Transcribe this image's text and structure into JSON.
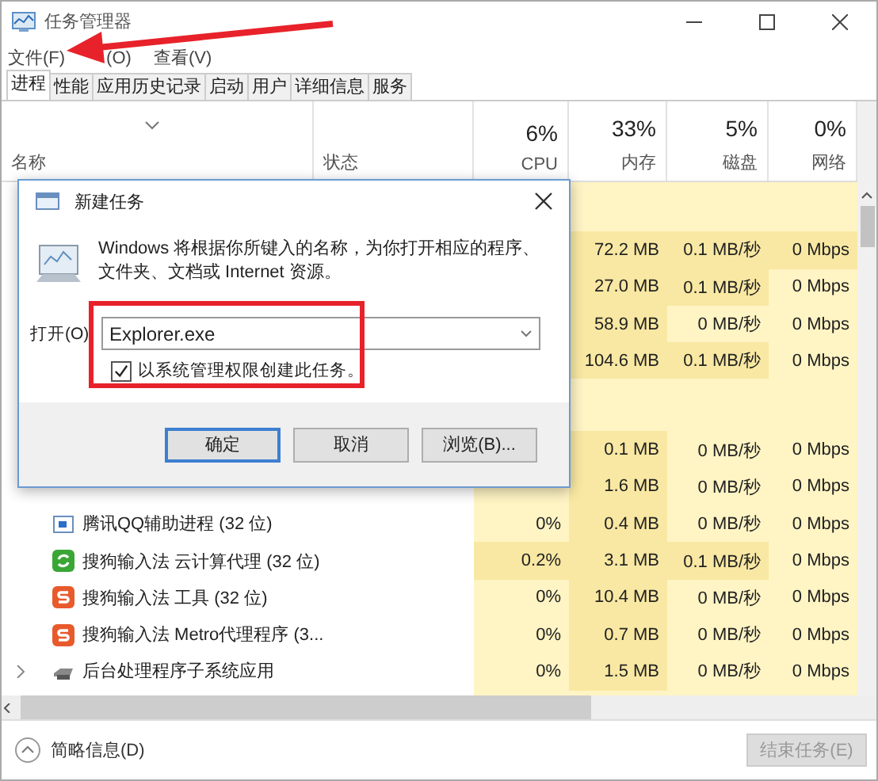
{
  "window": {
    "title": "任务管理器"
  },
  "menu": [
    "文件(F)",
    "(O)",
    "查看(V)"
  ],
  "tabs": [
    {
      "label": "进程",
      "selected": true
    },
    {
      "label": "性能",
      "selected": false
    },
    {
      "label": "应用历史记录",
      "selected": false
    },
    {
      "label": "启动",
      "selected": false
    },
    {
      "label": "用户",
      "selected": false
    },
    {
      "label": "详细信息",
      "selected": false
    },
    {
      "label": "服务",
      "selected": false
    }
  ],
  "columns": [
    {
      "label": "名称"
    },
    {
      "label": "状态"
    },
    {
      "label": "CPU",
      "total": "6%"
    },
    {
      "label": "内存",
      "total": "33%"
    },
    {
      "label": "磁盘",
      "total": "5%"
    },
    {
      "label": "网络",
      "total": "0%"
    }
  ],
  "rows": [
    {
      "kind": "group"
    },
    {
      "kind": "process",
      "memory": "72.2 MB",
      "disk": "0.1 MB/秒",
      "network": "0 Mbps",
      "disk_hot": true,
      "network_hot": true
    },
    {
      "kind": "process",
      "memory": "27.0 MB",
      "disk": "0.1 MB/秒",
      "network": "0 Mbps",
      "disk_hot": true
    },
    {
      "kind": "process",
      "memory": "58.9 MB",
      "disk": "0 MB/秒",
      "network": "0 Mbps"
    },
    {
      "kind": "process",
      "memory": "104.6 MB",
      "disk": "0.1 MB/秒",
      "network": "0 Mbps",
      "disk_hot": true
    },
    {
      "kind": "group"
    },
    {
      "kind": "process",
      "memory": "0.1 MB",
      "disk": "0 MB/秒",
      "network": "0 Mbps"
    },
    {
      "kind": "process",
      "memory": "1.6 MB",
      "disk": "0 MB/秒",
      "network": "0 Mbps"
    },
    {
      "kind": "window",
      "name": "腾讯QQ辅助进程 (32 位)",
      "cpu": "0%",
      "memory": "0.4 MB",
      "disk": "0 MB/秒",
      "network": "0 Mbps"
    },
    {
      "kind": "cloud",
      "name": "搜狗输入法 云计算代理 (32 位)",
      "cpu": "0.2%",
      "memory": "3.1 MB",
      "disk": "0.1 MB/秒",
      "network": "0 Mbps",
      "cpu_hot": true,
      "disk_hot": true
    },
    {
      "kind": "tool",
      "name": "搜狗输入法 工具 (32 位)",
      "cpu": "0%",
      "memory": "10.4 MB",
      "disk": "0 MB/秒",
      "network": "0 Mbps"
    },
    {
      "kind": "tool",
      "name": "搜狗输入法 Metro代理程序 (3...",
      "cpu": "0%",
      "memory": "0.7 MB",
      "disk": "0 MB/秒",
      "network": "0 Mbps"
    },
    {
      "kind": "service",
      "expandable": true,
      "name": "后台处理程序子系统应用",
      "cpu": "0%",
      "memory": "1.5 MB",
      "disk": "0 MB/秒",
      "network": "0 Mbps"
    }
  ],
  "footer": {
    "details": "简略信息(D)",
    "end_task": {
      "label": "结束任务(E)",
      "disabled": true
    }
  },
  "dialog": {
    "title": "新建任务",
    "message": "Windows 将根据你所键入的名称，为你打开相应的程序、文件夹、文档或 Internet 资源。",
    "open_label": "打开(O)",
    "value": "Explorer.exe",
    "admin": {
      "label": "以系统管理权限创建此任务。",
      "checked": true
    },
    "buttons": [
      {
        "label": "确定",
        "default": true
      },
      {
        "label": "取消",
        "default": false
      },
      {
        "label": "浏览(B)...",
        "default": false
      }
    ]
  }
}
